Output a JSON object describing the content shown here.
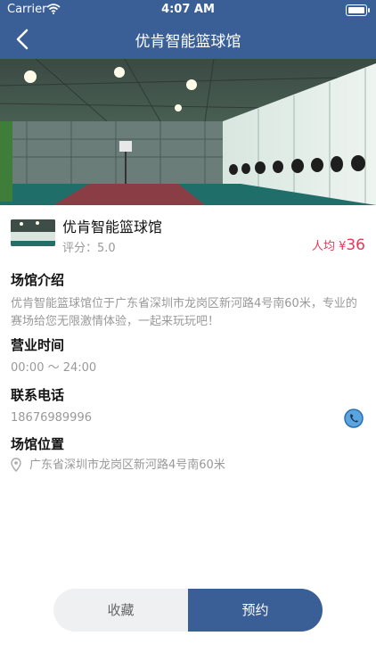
{
  "status_bar": {
    "carrier": "Carrier",
    "time": "4:07 AM"
  },
  "nav": {
    "title": "优肯智能篮球馆"
  },
  "venue": {
    "name": "优肯智能篮球馆",
    "rating_label": "评分：",
    "rating": "5.0",
    "price_prefix": "人均 ¥",
    "price": "36"
  },
  "intro": {
    "title": "场馆介绍",
    "text": "优肯智能篮球馆位于广东省深圳市龙岗区新河路4号南60米，专业的赛场给您无限激情体验，一起来玩玩吧！"
  },
  "hours": {
    "title": "营业时间",
    "value": "00:00 ～ 24:00"
  },
  "contact": {
    "title": "联系电话",
    "phone": "18676989996"
  },
  "location": {
    "title": "场馆位置",
    "address": "广东省深圳市龙岗区新河路4号南60米"
  },
  "actions": {
    "favorite_label": "收藏",
    "book_label": "预约"
  },
  "colors": {
    "primary": "#3a5f96",
    "price": "#e23a5a",
    "muted": "#999999"
  }
}
